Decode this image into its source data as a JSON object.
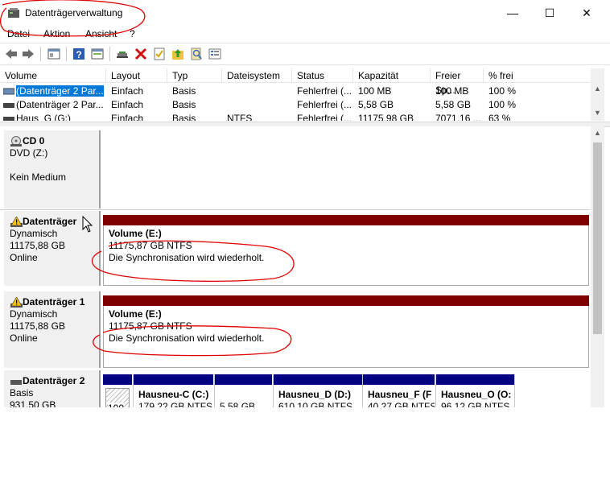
{
  "window": {
    "title": "Datenträgerverwaltung"
  },
  "menu": [
    "Datei",
    "Aktion",
    "Ansicht",
    "?"
  ],
  "toolbar": [
    "back-icon",
    "forward-icon",
    "console-icon",
    "help-icon",
    "properties-icon",
    "connect-icon",
    "delete-icon",
    "check-icon",
    "folder-up-icon",
    "search-icon",
    "list-icon"
  ],
  "volume_list": {
    "columns": [
      "Volume",
      "Layout",
      "Typ",
      "Dateisystem",
      "Status",
      "Kapazität",
      "Freier Sp...",
      "% frei"
    ],
    "rows": [
      [
        "(Datenträger 2 Par...",
        "Einfach",
        "Basis",
        "",
        "Fehlerfrei (...",
        "100 MB",
        "100 MB",
        "100 %"
      ],
      [
        "(Datenträger 2 Par...",
        "Einfach",
        "Basis",
        "",
        "Fehlerfrei (...",
        "5,58 GB",
        "5,58 GB",
        "100 %"
      ],
      [
        "Haus_G (G:)",
        "Einfach",
        "Basis",
        "NTFS",
        "Fehlerfrei (...",
        "11175,98 GB",
        "7071,16 ...",
        "63 %"
      ]
    ]
  },
  "disks": {
    "cd0": {
      "name": "CD 0",
      "line1": "DVD (Z:)",
      "line2": "",
      "line3": "Kein Medium"
    },
    "d0": {
      "name": "Datenträger",
      "line1": "Dynamisch",
      "line2": "11175,88 GB",
      "line3": "Online",
      "vol_name": "Volume (E:)",
      "vol_size": "11175,87 GB NTFS",
      "vol_status": "Die Synchronisation wird wiederholt."
    },
    "d1": {
      "name": "Datenträger 1",
      "line1": "Dynamisch",
      "line2": "11175,88 GB",
      "line3": "Online",
      "vol_name": "Volume (E:)",
      "vol_size": "11175,87 GB NTFS",
      "vol_status": "Die Synchronisation wird wiederholt."
    },
    "d2": {
      "name": "Datenträger 2",
      "line1": "Basis",
      "line2": "931,50 GB",
      "parts": [
        {
          "label": "",
          "size": "100"
        },
        {
          "label": "Hausneu-C (C:)",
          "size": "179,22 GB NTFS"
        },
        {
          "label": "",
          "size": "5,58 GB"
        },
        {
          "label": "Hausneu_D (D:)",
          "size": "610,10 GB NTFS"
        },
        {
          "label": "Hausneu_F (F",
          "size": "40,27 GB NTFS"
        },
        {
          "label": "Hausneu_O (O:",
          "size": "96,12 GB NTFS"
        }
      ]
    }
  },
  "colors": {
    "dynamic_volume": "#7f0000",
    "basic_primary": "#000080",
    "selection": "#0078d7",
    "annotation": "#e00000"
  }
}
